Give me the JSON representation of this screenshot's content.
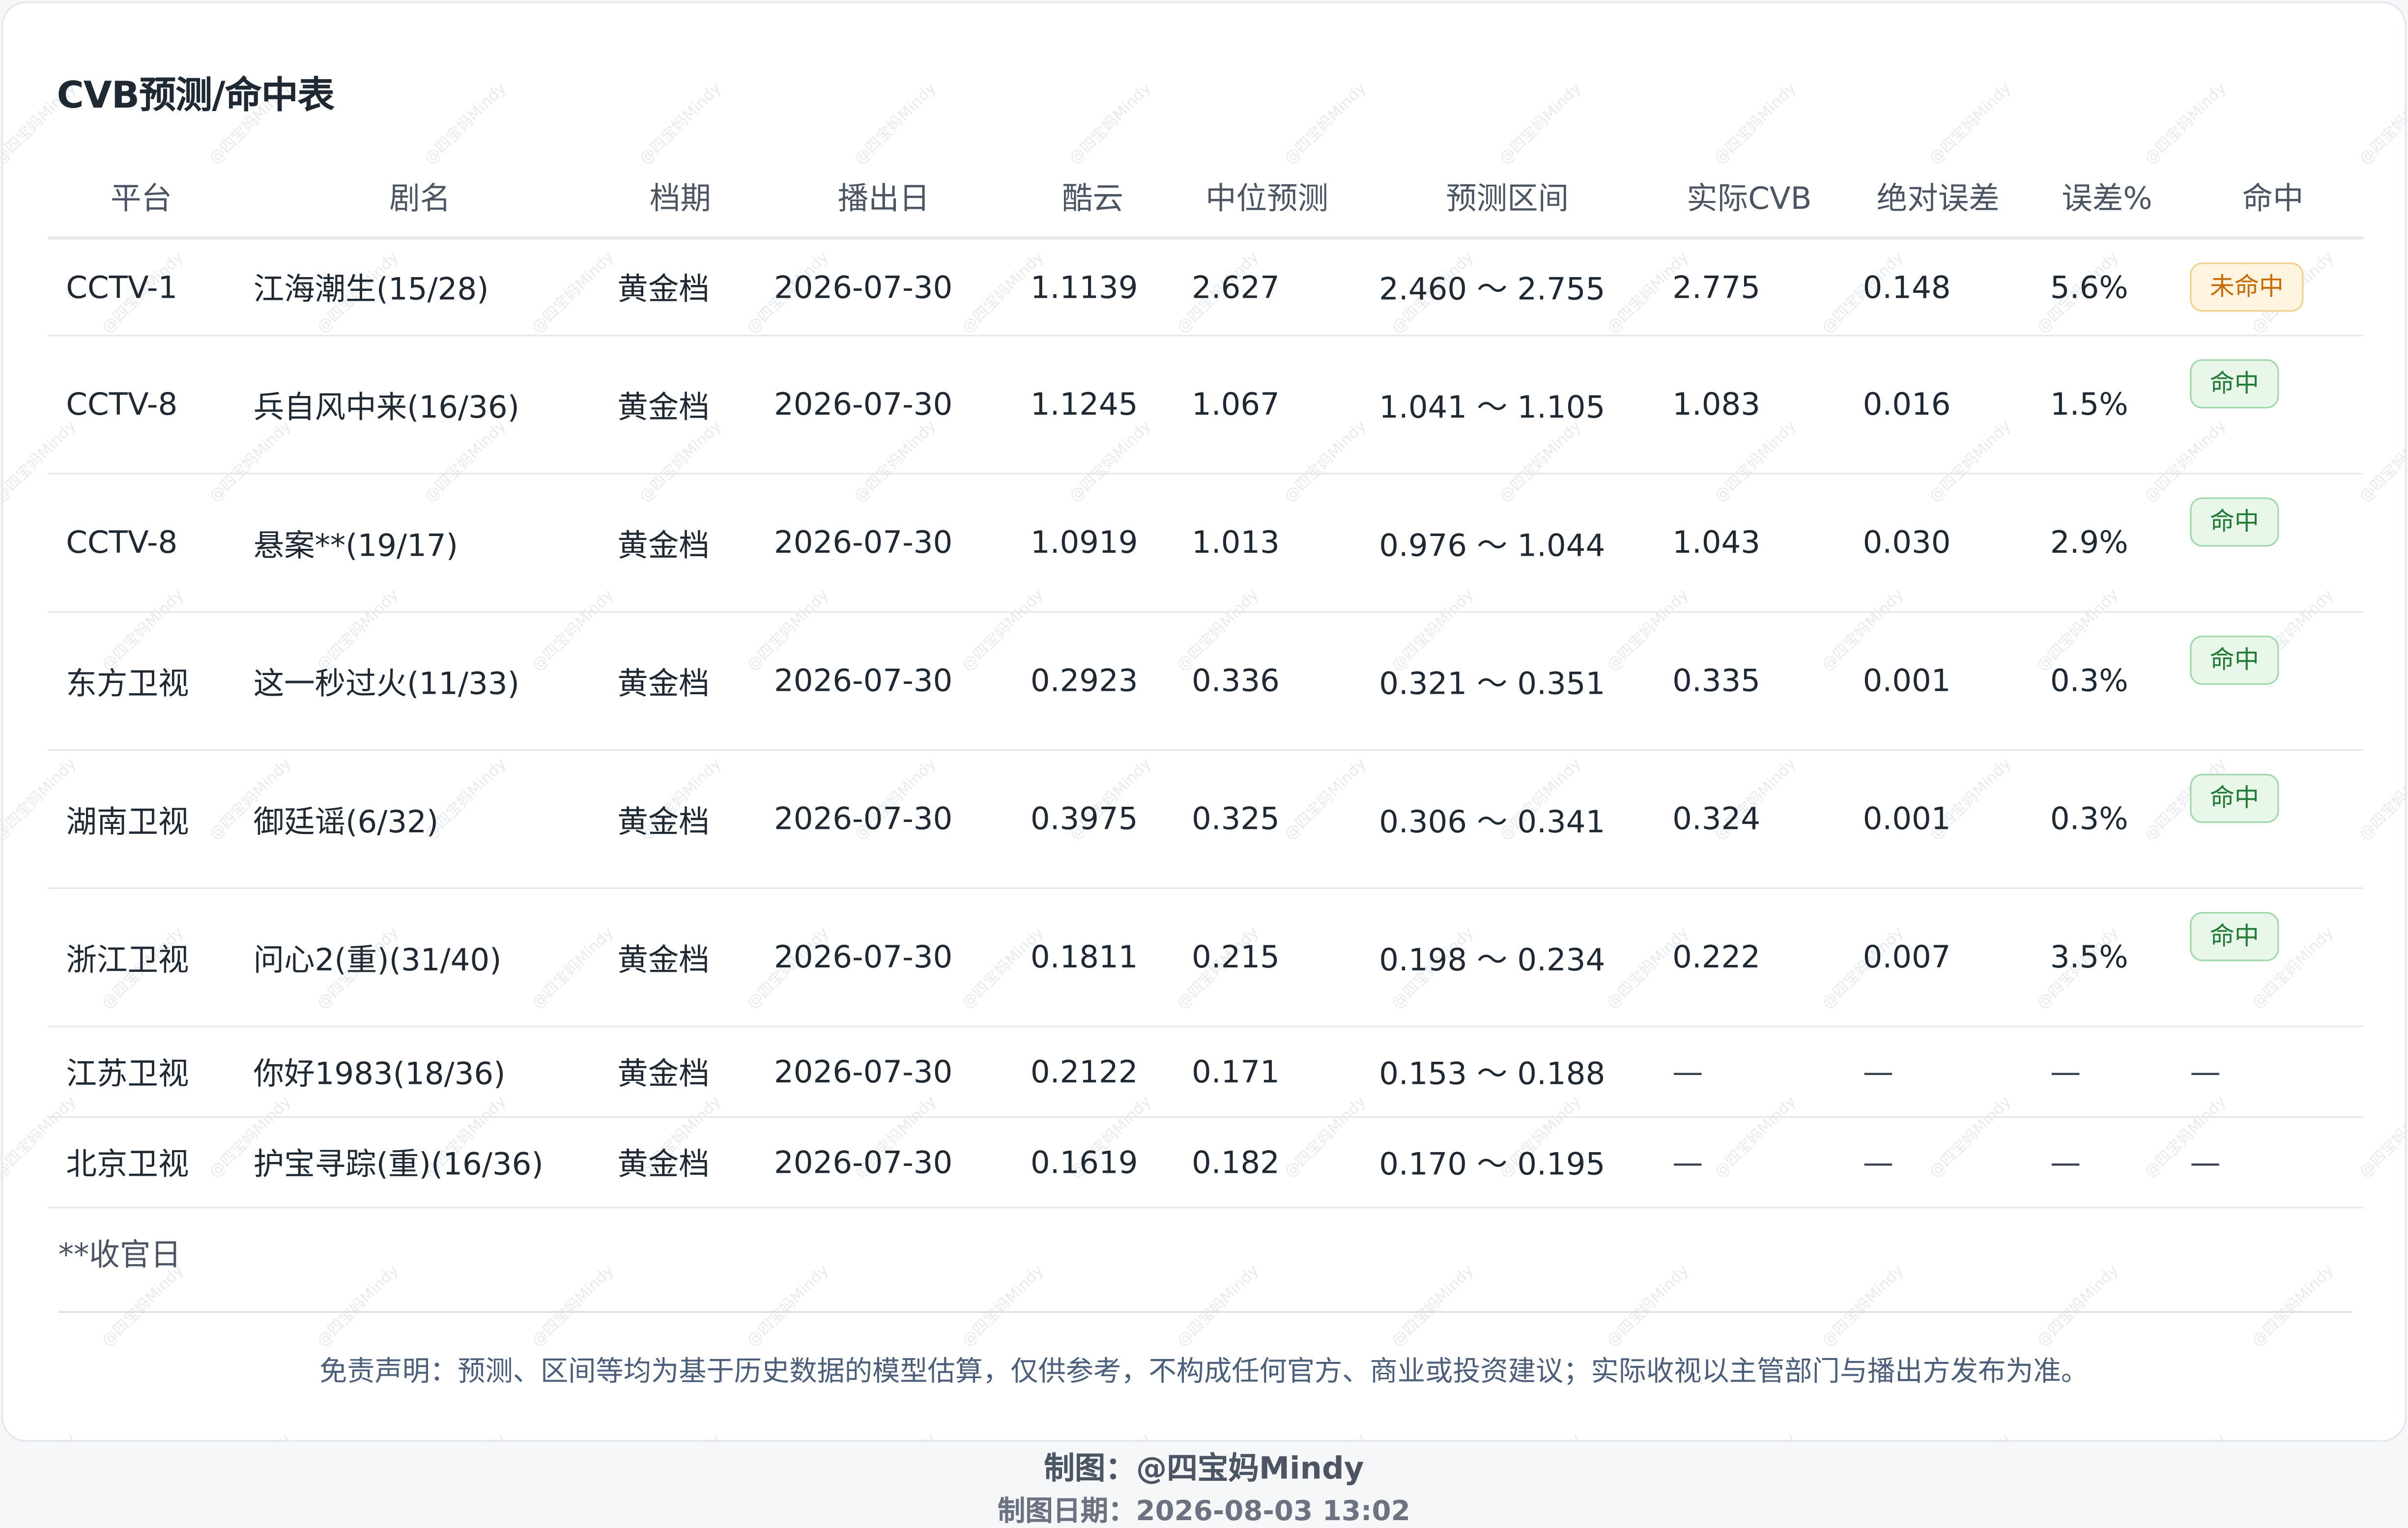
{
  "title": "CVB预测/命中表",
  "columns": [
    "平台",
    "剧名",
    "档期",
    "播出日",
    "酷云",
    "中位预测",
    "预测区间",
    "实际CVB",
    "绝对误差",
    "误差%",
    "命中"
  ],
  "rows": [
    {
      "platform": "CCTV-1",
      "show": "江海潮生(15/28)",
      "slot": "黄金档",
      "date": "2026-07-30",
      "kuyun": "1.1139",
      "median": "2.627",
      "range": "2.460 ～ 2.755",
      "actual": "2.775",
      "abs_err": "0.148",
      "err_pct": "5.6%",
      "hit": "未命中",
      "status": "miss"
    },
    {
      "platform": "CCTV-8",
      "show": "兵自风中来(16/36)",
      "slot": "黄金档",
      "date": "2026-07-30",
      "kuyun": "1.1245",
      "median": "1.067",
      "range": "1.041 ～ 1.105",
      "actual": "1.083",
      "abs_err": "0.016",
      "err_pct": "1.5%",
      "hit": "命中",
      "status": "hit"
    },
    {
      "platform": "CCTV-8",
      "show": "悬案**(19/17)",
      "slot": "黄金档",
      "date": "2026-07-30",
      "kuyun": "1.0919",
      "median": "1.013",
      "range": "0.976 ～ 1.044",
      "actual": "1.043",
      "abs_err": "0.030",
      "err_pct": "2.9%",
      "hit": "命中",
      "status": "hit"
    },
    {
      "platform": "东方卫视",
      "show": "这一秒过火(11/33)",
      "slot": "黄金档",
      "date": "2026-07-30",
      "kuyun": "0.2923",
      "median": "0.336",
      "range": "0.321 ～ 0.351",
      "actual": "0.335",
      "abs_err": "0.001",
      "err_pct": "0.3%",
      "hit": "命中",
      "status": "hit"
    },
    {
      "platform": "湖南卫视",
      "show": "御廷谣(6/32)",
      "slot": "黄金档",
      "date": "2026-07-30",
      "kuyun": "0.3975",
      "median": "0.325",
      "range": "0.306 ～ 0.341",
      "actual": "0.324",
      "abs_err": "0.001",
      "err_pct": "0.3%",
      "hit": "命中",
      "status": "hit"
    },
    {
      "platform": "浙江卫视",
      "show": "问心2(重)(31/40)",
      "slot": "黄金档",
      "date": "2026-07-30",
      "kuyun": "0.1811",
      "median": "0.215",
      "range": "0.198 ～ 0.234",
      "actual": "0.222",
      "abs_err": "0.007",
      "err_pct": "3.5%",
      "hit": "命中",
      "status": "hit"
    },
    {
      "platform": "江苏卫视",
      "show": "你好1983(18/36)",
      "slot": "黄金档",
      "date": "2026-07-30",
      "kuyun": "0.2122",
      "median": "0.171",
      "range": "0.153 ～ 0.188",
      "actual": "—",
      "abs_err": "—",
      "err_pct": "—",
      "hit": "—",
      "status": "none"
    },
    {
      "platform": "北京卫视",
      "show": "护宝寻踪(重)(16/36)",
      "slot": "黄金档",
      "date": "2026-07-30",
      "kuyun": "0.1619",
      "median": "0.182",
      "range": "0.170 ～ 0.195",
      "actual": "—",
      "abs_err": "—",
      "err_pct": "—",
      "hit": "—",
      "status": "none"
    }
  ],
  "footnote": "**收官日",
  "disclaimer": "免责声明：预测、区间等均为基于历史数据的模型估算，仅供参考，不构成任何官方、商业或投资建议；实际收视以主管部门与播出方发布为准。",
  "credit": "制图：@四宝妈Mindy",
  "credit_date": "制图日期：2026-08-03 13:02",
  "watermark": "@四宝妈Mindy",
  "colors": {
    "hit_bg": "#e8f7ea",
    "hit_text": "#207a35",
    "miss_bg": "#fff4df",
    "miss_text": "#c86b00"
  }
}
